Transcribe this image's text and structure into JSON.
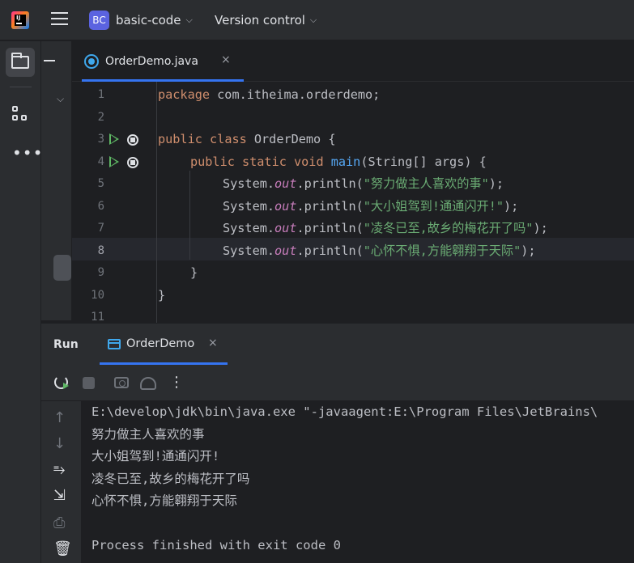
{
  "header": {
    "project_badge": "BC",
    "project_name": "basic-code",
    "vcs_menu": "Version control",
    "icons": [
      "app-logo-icon",
      "hamburger-menu-icon",
      "chevron-down-icon"
    ]
  },
  "left_toolbar": {
    "icons": [
      "folder-icon",
      "structure-icon",
      "more-icon"
    ]
  },
  "editor": {
    "tab": {
      "label": "OrderDemo.java",
      "close": "×",
      "icon": "java-class-icon"
    },
    "current_line": 8,
    "lines": [
      {
        "n": "1"
      },
      {
        "n": "2"
      },
      {
        "n": "3"
      },
      {
        "n": "4"
      },
      {
        "n": "5"
      },
      {
        "n": "6"
      },
      {
        "n": "7"
      },
      {
        "n": "8"
      },
      {
        "n": "9"
      },
      {
        "n": "10"
      },
      {
        "n": "11"
      }
    ],
    "code": {
      "l1_kw": "package",
      "l1_rest": " com.itheima.orderdemo;",
      "l3_kw1": "public",
      "l3_kw2": "class",
      "l3_rest": " OrderDemo {",
      "l4_kw": "public static void",
      "l4_fn": "main",
      "l4_rest": "(String[] args) {",
      "sys": "System.",
      "out": "out",
      "println": ".println(",
      "l5_str": "\"努力做主人喜欢的事\"",
      "l6_str": "\"大小姐驾到!通通闪开!\"",
      "l7_str": "\"凌冬已至,故乡的梅花开了吗\"",
      "l8_str": "\"心怀不惧,方能翱翔于天际\"",
      "stmt_end": ");",
      "l9": "}",
      "l10": "}"
    }
  },
  "run_panel": {
    "title": "Run",
    "tab_label": "OrderDemo",
    "tab_close": "×",
    "more": "⋮",
    "side_icons": [
      "arrow-up-icon",
      "arrow-down-icon",
      "soft-wrap-icon",
      "scroll-to-end-icon",
      "print-icon",
      "trash-icon"
    ],
    "console": [
      "E:\\develop\\jdk\\bin\\java.exe \"-javaagent:E:\\Program Files\\JetBrains\\",
      "努力做主人喜欢的事",
      "大小姐驾到!通通闪开!",
      "凌冬已至,故乡的梅花开了吗",
      "心怀不惧,方能翱翔于天际",
      "",
      "Process finished with exit code 0"
    ]
  }
}
